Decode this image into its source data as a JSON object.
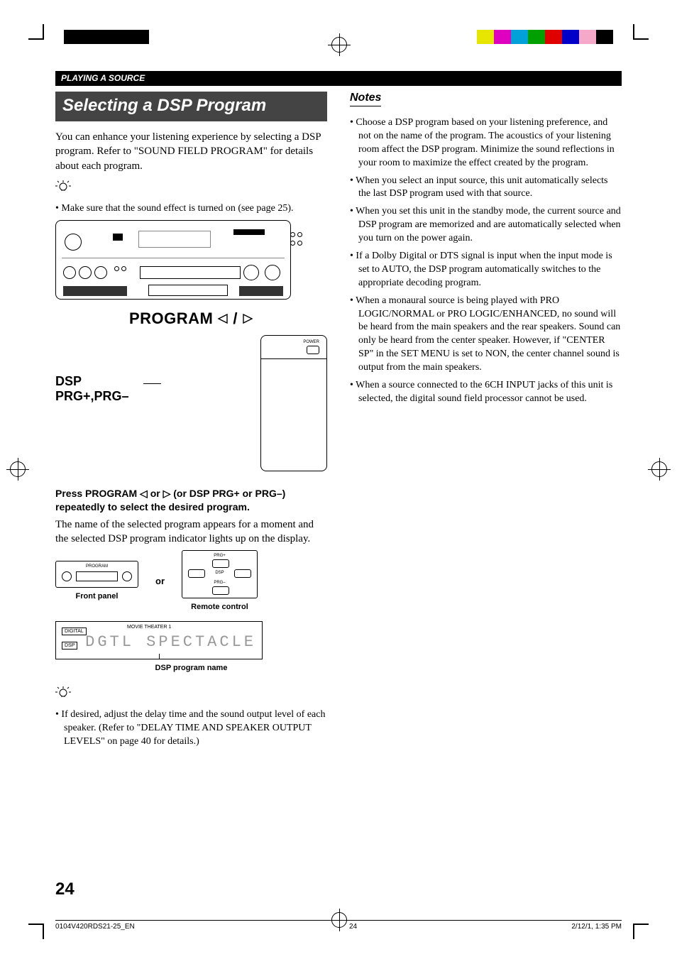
{
  "section_header": "PLAYING A SOURCE",
  "title": "Selecting a DSP Program",
  "intro": "You can enhance your listening experience by selecting a DSP program. Refer to \"SOUND FIELD PROGRAM\" for details about each program.",
  "precheck": "Make sure that the sound effect is turned on (see page 25).",
  "program_label": "PROGRAM",
  "dsp_line1": "DSP",
  "dsp_line2": "PRG+,PRG–",
  "step_text": "Press PROGRAM ◁ or ▷ (or DSP PRG+ or PRG–) repeatedly to select the desired program.",
  "step_body": "The name of the selected program appears for a moment and the selected DSP program indicator lights up on the display.",
  "or": "or",
  "fp_caption": "Front panel",
  "fp_tiny": "PROGRAM",
  "rc_caption": "Remote control",
  "rc_tiny_top": "PRG+",
  "rc_tiny_mid": "DSP",
  "rc_tiny_bot": "PRG–",
  "display_title": "MOVIE THEATER 1",
  "display_badge1": "DIGITAL",
  "display_badge2": "DSP",
  "display_text": "DGTL  SPECTACLE",
  "display_caption": "DSP program name",
  "tip": "If desired, adjust the delay time and the sound output level of each speaker. (Refer to \"DELAY TIME AND SPEAKER OUTPUT LEVELS\" on page 40 for details.)",
  "notes_label": "Notes",
  "notes": [
    "Choose a DSP program based on your listening preference, and not on the name of the program. The acoustics of your listening room affect the DSP program. Minimize the sound reflections in your room to maximize the effect created by the program.",
    "When you select an input source, this unit automatically selects the last DSP program used with that source.",
    "When you set this unit in the standby mode, the current source and DSP program are memorized and are automatically selected when you turn on the power again.",
    "If a Dolby Digital or DTS signal is input when the input mode is set to AUTO, the DSP program automatically switches to the appropriate decoding program.",
    "When a monaural source is being played with PRO LOGIC/NORMAL or PRO LOGIC/ENHANCED, no sound will be heard from the main speakers and the rear speakers. Sound can only be heard from the center speaker. However, if \"CENTER SP\" in the SET MENU is set to NON, the center channel sound is output from the main speakers.",
    "When a source connected to the 6CH INPUT jacks of this unit is selected, the digital sound field processor cannot be used."
  ],
  "page_number": "24",
  "footer_left": "0104V420RDS21-25_EN",
  "footer_center": "24",
  "footer_right": "2/12/1, 1:35 PM",
  "bar_colors_left": [
    "#000",
    "#000",
    "#000",
    "#000",
    "#000"
  ],
  "bar_colors_right": [
    "#e6e600",
    "#e000c0",
    "#00a0d8",
    "#00a000",
    "#e00000",
    "#0000c8",
    "#f5a8c8",
    "#000"
  ]
}
